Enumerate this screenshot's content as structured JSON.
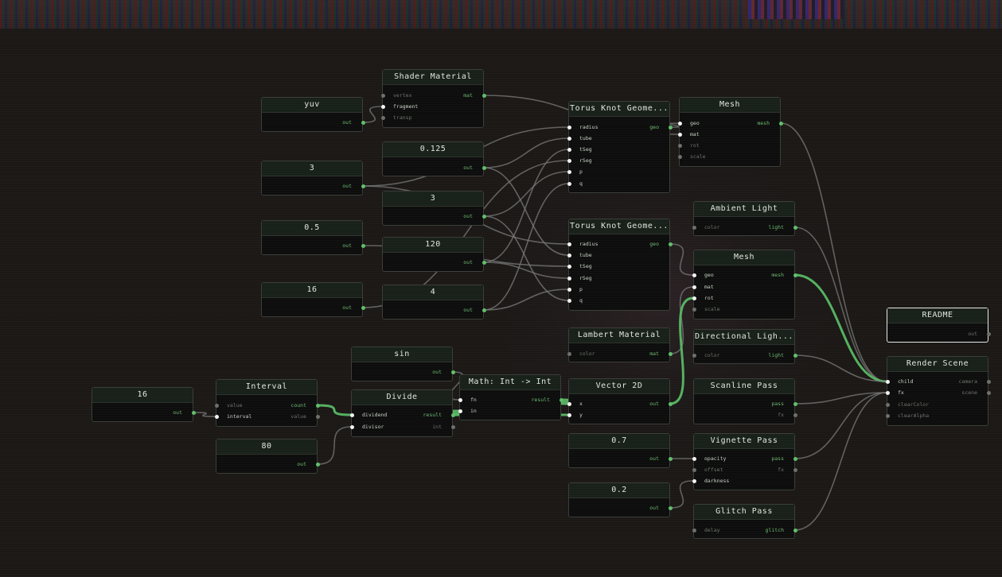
{
  "graph": {
    "nodes": [
      {
        "id": "shader-material",
        "title": "Shader Material",
        "inputs": [
          {
            "label": "vertex",
            "state": "unconnected"
          },
          {
            "label": "fragment",
            "state": "connected"
          },
          {
            "label": "transp",
            "state": "unconnected"
          }
        ],
        "outputs": [
          {
            "label": "mat",
            "state": "connected"
          }
        ]
      },
      {
        "id": "yuv",
        "title": "yuv",
        "inputs": [],
        "outputs": [
          {
            "label": "out",
            "state": "connected"
          }
        ]
      },
      {
        "id": "value-3a",
        "title": "3",
        "inputs": [],
        "outputs": [
          {
            "label": "out",
            "state": "connected"
          }
        ]
      },
      {
        "id": "value-0125",
        "title": "0.125",
        "inputs": [],
        "outputs": [
          {
            "label": "out",
            "state": "connected"
          }
        ]
      },
      {
        "id": "value-3b",
        "title": "3",
        "inputs": [],
        "outputs": [
          {
            "label": "out",
            "state": "connected"
          }
        ]
      },
      {
        "id": "value-05",
        "title": "0.5",
        "inputs": [],
        "outputs": [
          {
            "label": "out",
            "state": "connected"
          }
        ]
      },
      {
        "id": "value-120",
        "title": "120",
        "inputs": [],
        "outputs": [
          {
            "label": "out",
            "state": "connected"
          }
        ]
      },
      {
        "id": "value-16a",
        "title": "16",
        "inputs": [],
        "outputs": [
          {
            "label": "out",
            "state": "connected"
          }
        ]
      },
      {
        "id": "value-4",
        "title": "4",
        "inputs": [],
        "outputs": [
          {
            "label": "out",
            "state": "connected"
          }
        ]
      },
      {
        "id": "torus-1",
        "title": "Torus Knot Geome...",
        "inputs": [
          {
            "label": "radius",
            "state": "connected"
          },
          {
            "label": "tube",
            "state": "connected"
          },
          {
            "label": "tSeg",
            "state": "connected"
          },
          {
            "label": "rSeg",
            "state": "connected"
          },
          {
            "label": "p",
            "state": "connected"
          },
          {
            "label": "q",
            "state": "connected"
          }
        ],
        "outputs": [
          {
            "label": "geo",
            "state": "connected"
          }
        ]
      },
      {
        "id": "mesh-1",
        "title": "Mesh",
        "inputs": [
          {
            "label": "geo",
            "state": "connected"
          },
          {
            "label": "mat",
            "state": "connected"
          },
          {
            "label": "rot",
            "state": "unconnected"
          },
          {
            "label": "scale",
            "state": "unconnected"
          }
        ],
        "outputs": [
          {
            "label": "mesh",
            "state": "connected"
          }
        ]
      },
      {
        "id": "torus-2",
        "title": "Torus Knot Geome...",
        "inputs": [
          {
            "label": "radius",
            "state": "connected"
          },
          {
            "label": "tube",
            "state": "connected"
          },
          {
            "label": "tSeg",
            "state": "connected"
          },
          {
            "label": "rSeg",
            "state": "connected"
          },
          {
            "label": "p",
            "state": "connected"
          },
          {
            "label": "q",
            "state": "connected"
          }
        ],
        "outputs": [
          {
            "label": "geo",
            "state": "connected"
          }
        ]
      },
      {
        "id": "ambient-light",
        "title": "Ambient Light",
        "inputs": [
          {
            "label": "color",
            "state": "unconnected"
          }
        ],
        "outputs": [
          {
            "label": "light",
            "state": "connected"
          }
        ]
      },
      {
        "id": "mesh-2",
        "title": "Mesh",
        "inputs": [
          {
            "label": "geo",
            "state": "connected"
          },
          {
            "label": "mat",
            "state": "connected"
          },
          {
            "label": "rot",
            "state": "connected"
          },
          {
            "label": "scale",
            "state": "unconnected"
          }
        ],
        "outputs": [
          {
            "label": "mesh",
            "state": "connected"
          }
        ]
      },
      {
        "id": "readme",
        "title": "README",
        "inputs": [],
        "outputs": [
          {
            "label": "out",
            "state": "unconnected"
          }
        ]
      },
      {
        "id": "lambert-material",
        "title": "Lambert Material",
        "inputs": [
          {
            "label": "color",
            "state": "unconnected"
          }
        ],
        "outputs": [
          {
            "label": "mat",
            "state": "connected"
          }
        ]
      },
      {
        "id": "directional-light",
        "title": "Directional Ligh...",
        "inputs": [
          {
            "label": "color",
            "state": "unconnected"
          }
        ],
        "outputs": [
          {
            "label": "light",
            "state": "connected"
          }
        ]
      },
      {
        "id": "sin",
        "title": "sin",
        "inputs": [],
        "outputs": [
          {
            "label": "out",
            "state": "connected"
          }
        ]
      },
      {
        "id": "math-int",
        "title": "Math: Int -> Int",
        "inputs": [
          {
            "label": "fn",
            "state": "connected"
          },
          {
            "label": "in",
            "state": "connected"
          }
        ],
        "outputs": [
          {
            "label": "result",
            "state": "connected"
          }
        ]
      },
      {
        "id": "value-16b",
        "title": "16",
        "inputs": [],
        "outputs": [
          {
            "label": "out",
            "state": "connected"
          }
        ]
      },
      {
        "id": "interval",
        "title": "Interval",
        "inputs": [
          {
            "label": "value",
            "state": "unconnected"
          },
          {
            "label": "interval",
            "state": "connected"
          }
        ],
        "outputs": [
          {
            "label": "count",
            "state": "connected"
          },
          {
            "label": "value",
            "state": "unconnected"
          }
        ]
      },
      {
        "id": "divide",
        "title": "Divide",
        "inputs": [
          {
            "label": "dividend",
            "state": "connected"
          },
          {
            "label": "divisor",
            "state": "connected"
          }
        ],
        "outputs": [
          {
            "label": "result",
            "state": "connected"
          },
          {
            "label": "int",
            "state": "unconnected"
          }
        ]
      },
      {
        "id": "vector-2d",
        "title": "Vector 2D",
        "inputs": [
          {
            "label": "x",
            "state": "connected"
          },
          {
            "label": "y",
            "state": "connected"
          }
        ],
        "outputs": [
          {
            "label": "out",
            "state": "connected"
          }
        ]
      },
      {
        "id": "scanline-pass",
        "title": "Scanline Pass",
        "inputs": [],
        "outputs": [
          {
            "label": "pass",
            "state": "connected"
          },
          {
            "label": "fx",
            "state": "unconnected"
          }
        ]
      },
      {
        "id": "render-scene",
        "title": "Render Scene",
        "inputs": [
          {
            "label": "child",
            "state": "connected"
          },
          {
            "label": "fx",
            "state": "connected"
          },
          {
            "label": "clearColor",
            "state": "unconnected"
          },
          {
            "label": "clearAlpha",
            "state": "unconnected"
          }
        ],
        "outputs": [
          {
            "label": "camera",
            "state": "unconnected"
          },
          {
            "label": "scene",
            "state": "unconnected"
          }
        ]
      },
      {
        "id": "value-80",
        "title": "80",
        "inputs": [],
        "outputs": [
          {
            "label": "out",
            "state": "connected"
          }
        ]
      },
      {
        "id": "value-07",
        "title": "0.7",
        "inputs": [],
        "outputs": [
          {
            "label": "out",
            "state": "connected"
          }
        ]
      },
      {
        "id": "vignette-pass",
        "title": "Vignette Pass",
        "inputs": [
          {
            "label": "opacity",
            "state": "connected"
          },
          {
            "label": "offset",
            "state": "unconnected"
          },
          {
            "label": "darkness",
            "state": "connected"
          }
        ],
        "outputs": [
          {
            "label": "pass",
            "state": "connected"
          },
          {
            "label": "fx",
            "state": "unconnected"
          }
        ]
      },
      {
        "id": "value-02",
        "title": "0.2",
        "inputs": [],
        "outputs": [
          {
            "label": "out",
            "state": "connected"
          }
        ]
      },
      {
        "id": "glitch-pass",
        "title": "Glitch Pass",
        "inputs": [
          {
            "label": "delay",
            "state": "unconnected"
          }
        ],
        "outputs": [
          {
            "label": "glitch",
            "state": "connected"
          }
        ]
      }
    ],
    "connections": [
      {
        "from": "yuv.out",
        "to": "shader-material.fragment"
      },
      {
        "from": "shader-material.mat",
        "to": "mesh-1.mat"
      },
      {
        "from": "value-3a.out",
        "to": "torus-1.radius"
      },
      {
        "from": "value-3a.out",
        "to": "torus-2.radius"
      },
      {
        "from": "value-0125.out",
        "to": "torus-1.tube"
      },
      {
        "from": "value-120.out",
        "to": "torus-1.tSeg"
      },
      {
        "from": "value-16a.out",
        "to": "torus-1.rSeg"
      },
      {
        "from": "value-3b.out",
        "to": "torus-1.p"
      },
      {
        "from": "value-4.out",
        "to": "torus-1.q"
      },
      {
        "from": "value-0125.out",
        "to": "torus-2.tube"
      },
      {
        "from": "value-05.out",
        "to": "torus-2.tSeg"
      },
      {
        "from": "value-120.out",
        "to": "torus-2.rSeg"
      },
      {
        "from": "value-4.out",
        "to": "torus-2.p"
      },
      {
        "from": "value-3b.out",
        "to": "torus-2.q"
      },
      {
        "from": "torus-1.geo",
        "to": "mesh-1.geo"
      },
      {
        "from": "torus-2.geo",
        "to": "mesh-2.geo"
      },
      {
        "from": "lambert-material.mat",
        "to": "mesh-2.mat"
      },
      {
        "from": "vector-2d.out",
        "to": "mesh-2.rot",
        "highlight": true
      },
      {
        "from": "value-16b.out",
        "to": "interval.interval"
      },
      {
        "from": "interval.count",
        "to": "divide.dividend",
        "highlight": true
      },
      {
        "from": "value-80.out",
        "to": "divide.divisor"
      },
      {
        "from": "sin.out",
        "to": "math-int.fn"
      },
      {
        "from": "divide.result",
        "to": "math-int.in",
        "highlight": true
      },
      {
        "from": "divide.result",
        "to": "vector-2d.y",
        "highlight": true
      },
      {
        "from": "math-int.result",
        "to": "vector-2d.x",
        "highlight": true
      },
      {
        "from": "mesh-1.mesh",
        "to": "render-scene.child"
      },
      {
        "from": "ambient-light.light",
        "to": "render-scene.child"
      },
      {
        "from": "mesh-2.mesh",
        "to": "render-scene.child",
        "highlight": true
      },
      {
        "from": "directional-light.light",
        "to": "render-scene.child"
      },
      {
        "from": "scanline-pass.pass",
        "to": "render-scene.fx"
      },
      {
        "from": "vignette-pass.pass",
        "to": "render-scene.fx"
      },
      {
        "from": "glitch-pass.glitch",
        "to": "render-scene.fx"
      },
      {
        "from": "value-07.out",
        "to": "vignette-pass.opacity"
      },
      {
        "from": "value-02.out",
        "to": "vignette-pass.darkness"
      }
    ]
  },
  "colors": {
    "background": "#1b1816",
    "node_body": "#0c0d0c",
    "node_header": "#182019",
    "wire": "#7a7a7a",
    "wire_highlight": "#58b864",
    "port_connected_input": "#f2f2f2",
    "port_connected_output": "#5fbf6a",
    "port_unconnected": "#6c6f6a"
  }
}
